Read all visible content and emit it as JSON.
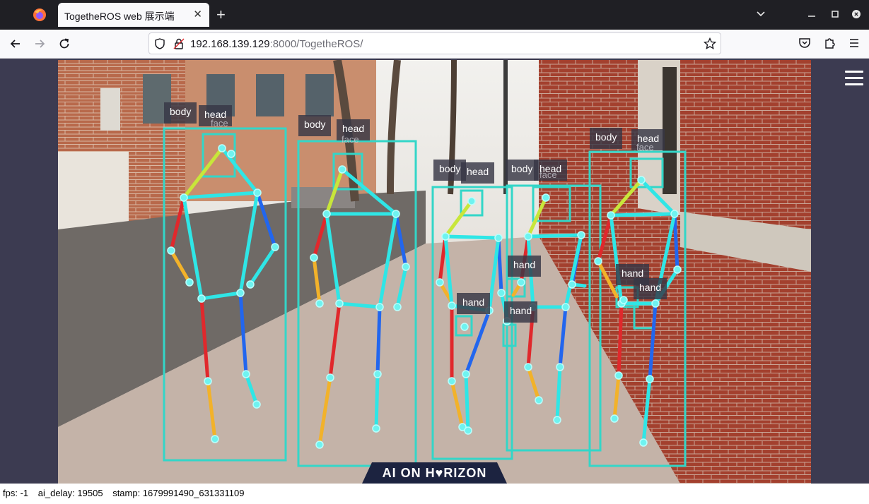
{
  "browser": {
    "tab_title": "TogetheROS web 展示端",
    "tab_close": "✕",
    "new_tab": "+",
    "url_host": "192.168.139.129",
    "url_rest": ":8000/TogetheROS/"
  },
  "labels": {
    "body": "body",
    "head": "head",
    "face": "face",
    "hand": "hand"
  },
  "brand": "AI ON H♥RIZON",
  "status": {
    "fps": "fps: -1",
    "ai_delay": "ai_delay: 19505",
    "stamp": "stamp: 1679991490_631331109"
  },
  "colors": {
    "box": "#33d6c8",
    "skeleton_cyan": "#2fe6e6",
    "skeleton_red": "#e0282c",
    "skeleton_blue": "#2266ee",
    "skeleton_yellow": "#f2b22a",
    "skeleton_lime": "#c8e63a"
  },
  "icons": [
    "firefox-logo-icon",
    "chevron-down-icon",
    "minimize-icon",
    "maximize-icon",
    "close-icon",
    "back-icon",
    "forward-icon",
    "reload-icon",
    "shield-icon",
    "lock-icon",
    "bookmark-star-icon",
    "pocket-icon",
    "extensions-icon",
    "app-menu-icon",
    "hamburger-menu-icon"
  ]
}
